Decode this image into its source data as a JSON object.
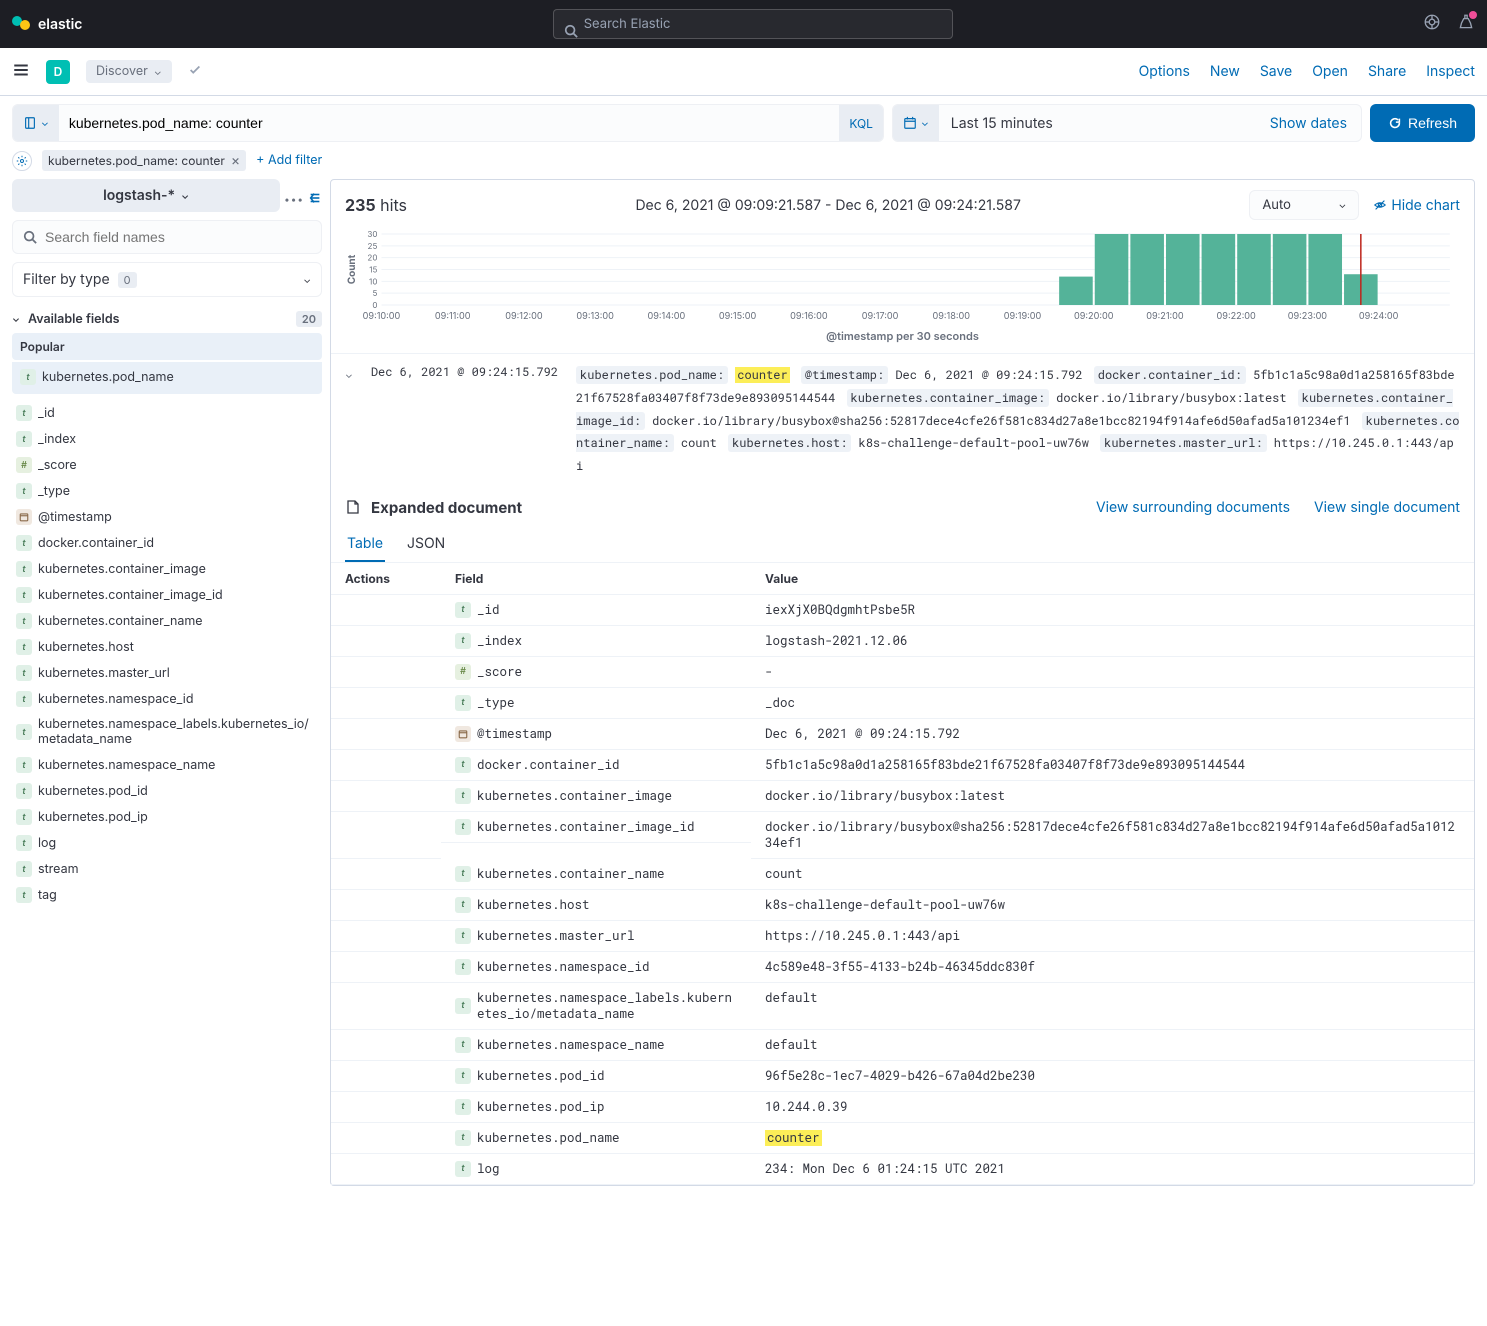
{
  "header": {
    "brand": "elastic",
    "search_placeholder": "Search Elastic",
    "avatar_initial": "D",
    "app_label": "Discover",
    "actions": [
      "Options",
      "New",
      "Save",
      "Open",
      "Share",
      "Inspect"
    ]
  },
  "query": {
    "input": "kubernetes.pod_name: counter",
    "lang": "KQL",
    "date_label": "Last 15 minutes",
    "show_dates": "Show dates",
    "refresh": "Refresh",
    "filter_pill": "kubernetes.pod_name: counter",
    "add_filter": "+ Add filter"
  },
  "sidebar": {
    "index_pattern": "logstash-*",
    "search_placeholder": "Search field names",
    "filter_by_type": "Filter by type",
    "filter_count": "0",
    "available_label": "Available fields",
    "available_count": "20",
    "popular_label": "Popular",
    "popular_fields": [
      {
        "type": "t",
        "name": "kubernetes.pod_name"
      }
    ],
    "fields": [
      {
        "type": "t",
        "name": "_id"
      },
      {
        "type": "t",
        "name": "_index"
      },
      {
        "type": "hash",
        "name": "_score"
      },
      {
        "type": "t",
        "name": "_type"
      },
      {
        "type": "date",
        "name": "@timestamp"
      },
      {
        "type": "t",
        "name": "docker.container_id"
      },
      {
        "type": "t",
        "name": "kubernetes.container_image"
      },
      {
        "type": "t",
        "name": "kubernetes.container_image_id"
      },
      {
        "type": "t",
        "name": "kubernetes.container_name"
      },
      {
        "type": "t",
        "name": "kubernetes.host"
      },
      {
        "type": "t",
        "name": "kubernetes.master_url"
      },
      {
        "type": "t",
        "name": "kubernetes.namespace_id"
      },
      {
        "type": "t",
        "name": "kubernetes.namespace_labels.kubernetes_io/metadata_name"
      },
      {
        "type": "t",
        "name": "kubernetes.namespace_name"
      },
      {
        "type": "t",
        "name": "kubernetes.pod_id"
      },
      {
        "type": "t",
        "name": "kubernetes.pod_ip"
      },
      {
        "type": "t",
        "name": "log"
      },
      {
        "type": "t",
        "name": "stream"
      },
      {
        "type": "t",
        "name": "tag"
      }
    ]
  },
  "content": {
    "hits": "235",
    "hits_label": "hits",
    "timerange": "Dec 6, 2021 @ 09:09:21.587 - Dec 6, 2021 @ 09:24:21.587",
    "interval": "Auto",
    "hide_chart": "Hide chart",
    "chart_caption": "@timestamp per 30 seconds"
  },
  "chart_data": {
    "type": "bar",
    "ylabel": "Count",
    "ylim": [
      0,
      30
    ],
    "yticks": [
      0,
      5,
      10,
      15,
      20,
      25,
      30
    ],
    "categories": [
      "09:10:00",
      "09:11:00",
      "09:12:00",
      "09:13:00",
      "09:14:00",
      "09:15:00",
      "09:16:00",
      "09:17:00",
      "09:18:00",
      "09:19:00",
      "09:20:00",
      "09:21:00",
      "09:22:00",
      "09:23:00",
      "09:24:00"
    ],
    "sub_interval_seconds": 30,
    "bars": [
      {
        "t": "09:19:30",
        "v": 12
      },
      {
        "t": "09:20:00",
        "v": 30
      },
      {
        "t": "09:20:30",
        "v": 30
      },
      {
        "t": "09:21:00",
        "v": 30
      },
      {
        "t": "09:21:30",
        "v": 30
      },
      {
        "t": "09:22:00",
        "v": 30
      },
      {
        "t": "09:22:30",
        "v": 30
      },
      {
        "t": "09:23:00",
        "v": 30
      },
      {
        "t": "09:23:30",
        "v": 13
      }
    ],
    "marker_time": "09:23:30"
  },
  "doc": {
    "timestamp": "Dec 6, 2021 @ 09:24:15.792",
    "summary": [
      {
        "k": "kubernetes.pod_name:",
        "v": "counter",
        "highlight": true
      },
      {
        "k": "@timestamp:",
        "v": "Dec 6, 2021 @ 09:24:15.792"
      },
      {
        "k": "docker.container_id:",
        "v": "5fb1c1a5c98a0d1a258165f83bde21f67528fa03407f8f73de9e893095144544"
      },
      {
        "k": "kubernetes.container_image:",
        "v": "docker.io/library/busybox:latest"
      },
      {
        "k": "kubernetes.container_image_id:",
        "v": "docker.io/library/busybox@sha256:52817dece4cfe26f581c834d27a8e1bcc82194f914afe6d50afad5a101234ef1"
      },
      {
        "k": "kubernetes.container_name:",
        "v": "count"
      },
      {
        "k": "kubernetes.host:",
        "v": "k8s-challenge-default-pool-uw76w"
      },
      {
        "k": "kubernetes.master_url:",
        "v": "https://10.245.0.1:443/api"
      }
    ],
    "expanded_title": "Expanded document",
    "view_surrounding": "View surrounding documents",
    "view_single": "View single document",
    "tabs": [
      "Table",
      "JSON"
    ],
    "table_headers": [
      "Actions",
      "Field",
      "Value"
    ],
    "rows": [
      {
        "type": "t",
        "field": "_id",
        "value": "iexXjX0BQdgmhtPsbe5R"
      },
      {
        "type": "t",
        "field": "_index",
        "value": "logstash-2021.12.06"
      },
      {
        "type": "hash",
        "field": "_score",
        "value": " - "
      },
      {
        "type": "t",
        "field": "_type",
        "value": "_doc"
      },
      {
        "type": "date",
        "field": "@timestamp",
        "value": "Dec 6, 2021 @ 09:24:15.792"
      },
      {
        "type": "t",
        "field": "docker.container_id",
        "value": "5fb1c1a5c98a0d1a258165f83bde21f67528fa03407f8f73de9e893095144544"
      },
      {
        "type": "t",
        "field": "kubernetes.container_image",
        "value": "docker.io/library/busybox:latest"
      },
      {
        "type": "t",
        "field": "kubernetes.container_image_id",
        "value": "docker.io/library/busybox@sha256:52817dece4cfe26f581c834d27a8e1bcc82194f914afe6d50afad5a101234ef1"
      },
      {
        "type": "t",
        "field": "kubernetes.container_name",
        "value": "count"
      },
      {
        "type": "t",
        "field": "kubernetes.host",
        "value": "k8s-challenge-default-pool-uw76w"
      },
      {
        "type": "t",
        "field": "kubernetes.master_url",
        "value": "https://10.245.0.1:443/api"
      },
      {
        "type": "t",
        "field": "kubernetes.namespace_id",
        "value": "4c589e48-3f55-4133-b24b-46345ddc830f"
      },
      {
        "type": "t",
        "field": "kubernetes.namespace_labels.kubernetes_io/metadata_name",
        "value": "default"
      },
      {
        "type": "t",
        "field": "kubernetes.namespace_name",
        "value": "default"
      },
      {
        "type": "t",
        "field": "kubernetes.pod_id",
        "value": "96f5e28c-1ec7-4029-b426-67a04d2be230"
      },
      {
        "type": "t",
        "field": "kubernetes.pod_ip",
        "value": "10.244.0.39"
      },
      {
        "type": "t",
        "field": "kubernetes.pod_name",
        "value": "counter",
        "highlight": true
      },
      {
        "type": "t",
        "field": "log",
        "value": "234: Mon Dec  6 01:24:15 UTC 2021"
      }
    ]
  }
}
